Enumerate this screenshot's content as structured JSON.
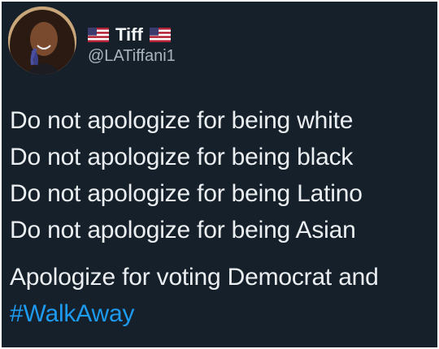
{
  "tweet": {
    "author": {
      "display_name": "Tiff",
      "handle": "@LATiffani1",
      "name_decorations": [
        "us-flag-icon",
        "us-flag-icon"
      ]
    },
    "lines": [
      "Do not apologize for being white",
      "Do not apologize for being black",
      "Do not apologize for being Latino",
      "Do not apologize for being Asian"
    ],
    "closing_line": "Apologize for voting Democrat and",
    "hashtag": "#WalkAway"
  },
  "colors": {
    "background": "#15202b",
    "text": "#eceff1",
    "secondary_text": "#a9b4bf",
    "link": "#1d9bf0"
  }
}
